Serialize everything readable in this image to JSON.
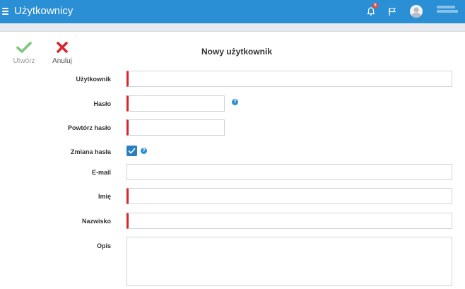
{
  "header": {
    "title": "Użytkownicy",
    "notification_count": "5",
    "colors": {
      "bar": "#2a8fd5",
      "badge": "#e8453c"
    },
    "icons": [
      "menu-icon",
      "bell-icon",
      "flag-icon",
      "avatar-icon"
    ]
  },
  "toolbar": {
    "create_label": "Utwórz",
    "cancel_label": "Anuluj",
    "icons": [
      "check-icon",
      "x-icon"
    ],
    "colors": {
      "check": "#5cb85c",
      "x": "#d9262c"
    }
  },
  "form": {
    "title": "Nowy użytkownik",
    "username_label": "Użytkownik",
    "username_value": "",
    "password_label": "Hasło",
    "password_value": "",
    "repeat_password_label": "Powtórz hasło",
    "repeat_password_value": "",
    "change_password_label": "Zmiana hasła",
    "change_password_checked": true,
    "email_label": "E-mail",
    "email_value": "",
    "first_name_label": "Imię",
    "first_name_value": "",
    "last_name_label": "Nazwisko",
    "last_name_value": "",
    "description_label": "Opis",
    "description_value": "",
    "required_color": "#d9262c",
    "help_icon": "question-icon"
  }
}
